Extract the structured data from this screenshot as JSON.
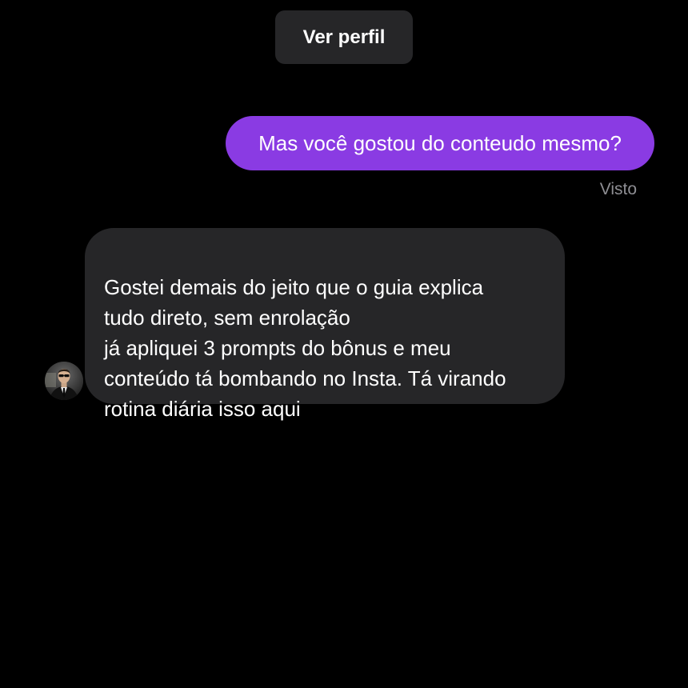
{
  "header": {
    "profile_button_label": "Ver perfil"
  },
  "messages": [
    {
      "direction": "outgoing",
      "text": "Mas você gostou do conteudo mesmo?",
      "status": "Visto"
    },
    {
      "direction": "incoming",
      "text": "Gostei demais do jeito que o guia explica\ntudo direto, sem enrolação\n já apliquei 3 prompts do bônus e meu\nconteúdo tá bombando no Insta. Tá virando\nrotina diária isso aqui",
      "avatar_icon": "user-avatar"
    }
  ],
  "colors": {
    "background": "#000000",
    "outgoing_bubble": "#8a3be3",
    "incoming_bubble": "#262628",
    "profile_button": "#262628",
    "status_text": "#8e8e93"
  }
}
